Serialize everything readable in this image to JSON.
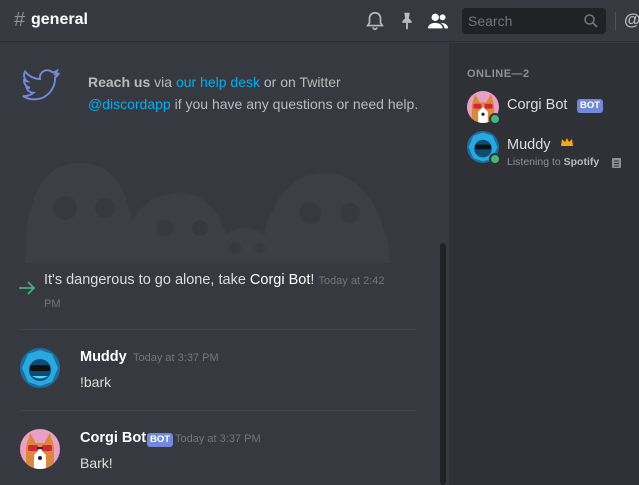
{
  "header": {
    "hash": "#",
    "channel": "general",
    "search_placeholder": "Search",
    "at": "@"
  },
  "welcome": {
    "reach_us": "Reach us",
    "via": " via ",
    "help_desk": "our help desk",
    "or_twitter": " or on Twitter",
    "handle": "@discordapp",
    "tail": " if you have any questions or need help."
  },
  "system_message": {
    "text_before": "It's dangerous to go alone, take ",
    "bot_name": "Corgi Bot",
    "text_after": "!",
    "timestamp": "Today at 2:42 PM"
  },
  "messages": [
    {
      "author": "Muddy",
      "timestamp": "Today at 3:37 PM",
      "content": "!bark",
      "bot": ""
    },
    {
      "author": "Corgi Bot",
      "timestamp": "Today at 3:37 PM",
      "content": "Bark!",
      "bot": "BOT"
    }
  ],
  "members": {
    "group_label": "ONLINE—2",
    "list": [
      {
        "name": "Corgi Bot",
        "tag": "BOT",
        "activity": ""
      },
      {
        "name": "Muddy",
        "activity_prefix": "Listening to ",
        "activity_name": "Spotify"
      }
    ]
  },
  "colors": {
    "accent": "#7289da",
    "link": "#00b0f4",
    "online": "#43b581",
    "background": "#36393f",
    "sidebar": "#2f3136"
  },
  "icons": [
    "bell-icon",
    "pin-icon",
    "members-icon",
    "search-icon",
    "at-icon",
    "twitter-icon",
    "arrow-icon",
    "crown-icon",
    "spotify-icon"
  ]
}
